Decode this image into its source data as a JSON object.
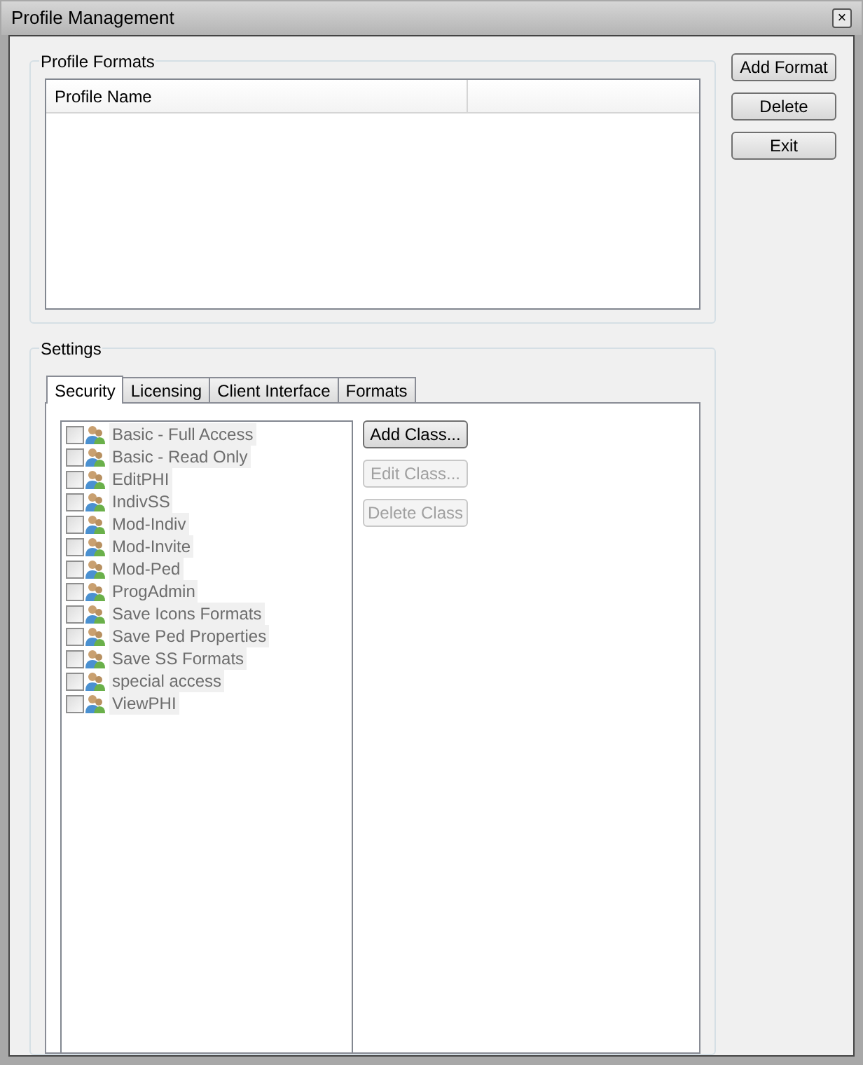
{
  "window": {
    "title": "Profile Management",
    "close": "×"
  },
  "profile_formats": {
    "title": "Profile Formats",
    "columns": [
      "Profile Name"
    ]
  },
  "side_buttons": [
    {
      "label": "Add Format",
      "disabled": false
    },
    {
      "label": "Delete",
      "disabled": false
    },
    {
      "label": "Exit",
      "disabled": false
    }
  ],
  "settings": {
    "title": "Settings",
    "tabs": [
      {
        "label": "Security",
        "selected": true
      },
      {
        "label": "Licensing",
        "selected": false
      },
      {
        "label": "Client Interface",
        "selected": false
      },
      {
        "label": "Formats",
        "selected": false
      }
    ],
    "classes": [
      {
        "label": "Basic - Full Access",
        "checked": false
      },
      {
        "label": "Basic - Read Only",
        "checked": false
      },
      {
        "label": "EditPHI",
        "checked": false
      },
      {
        "label": "IndivSS",
        "checked": false
      },
      {
        "label": "Mod-Indiv",
        "checked": false
      },
      {
        "label": "Mod-Invite",
        "checked": false
      },
      {
        "label": "Mod-Ped",
        "checked": false
      },
      {
        "label": "ProgAdmin",
        "checked": false
      },
      {
        "label": "Save Icons Formats",
        "checked": false
      },
      {
        "label": "Save Ped Properties",
        "checked": false
      },
      {
        "label": "Save SS Formats",
        "checked": false
      },
      {
        "label": "special access",
        "checked": false
      },
      {
        "label": "ViewPHI",
        "checked": false
      }
    ],
    "class_buttons": [
      {
        "label": "Add Class...",
        "disabled": false
      },
      {
        "label": "Edit Class...",
        "disabled": true
      },
      {
        "label": "Delete Class",
        "disabled": true
      }
    ]
  }
}
